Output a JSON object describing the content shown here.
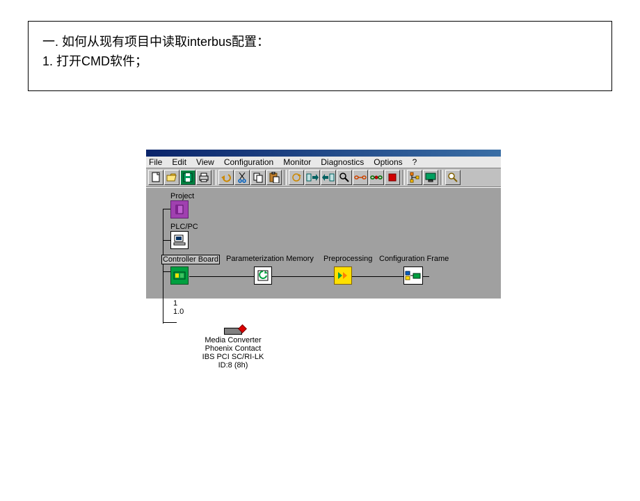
{
  "instructions": {
    "line1": "一.   如何从现有项目中读取interbus配置：",
    "line2": "1.   打开CMD软件；"
  },
  "menu": {
    "file": "File",
    "edit": "Edit",
    "view": "View",
    "configuration": "Configuration",
    "monitor": "Monitor",
    "diagnostics": "Diagnostics",
    "options": "Options",
    "help": "?"
  },
  "toolbar_icons": {
    "new": "new-icon",
    "open": "open-icon",
    "save": "save-icon",
    "print": "print-icon",
    "undo": "undo-icon",
    "cut": "cut-icon",
    "copy": "copy-icon",
    "paste": "paste-icon",
    "refresh": "refresh-icon",
    "export1": "export-right-icon",
    "export2": "export-left-icon",
    "find": "find-icon",
    "link": "link-icon",
    "disconnect": "disconnect-icon",
    "red_square": "stop-icon",
    "diagram": "diagram-icon",
    "monitor": "monitor-icon",
    "zoom": "zoom-icon"
  },
  "tree": {
    "project": "Project",
    "plcpc": "PLC/PC",
    "controller_board": "Controller Board",
    "param_memory": "Parameterization Memory",
    "preprocessing": "Preprocessing",
    "config_frame": "Configuration Frame"
  },
  "device": {
    "num": "1",
    "addr": "1.0",
    "name": "Media Converter",
    "vendor": "Phoenix Contact",
    "type": "IBS PCI SC/RI-LK",
    "id": "ID:8 (8h)"
  }
}
